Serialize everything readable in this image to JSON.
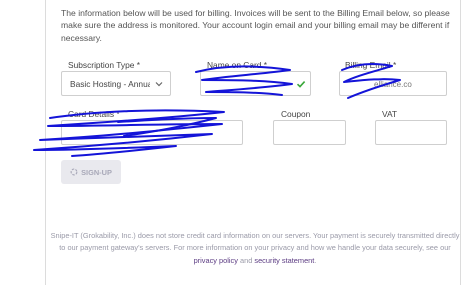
{
  "intro_text": "The information below will be used for billing. Invoices will be sent to the Billing Email below, so please make sure the address is monitored. Your account login email and your billing email may be different if necessary.",
  "form": {
    "subscription_type": {
      "label": "Subscription Type *",
      "value": "Basic Hosting - Annua"
    },
    "name_on_card": {
      "label": "Name on Card *",
      "value": ""
    },
    "billing_email": {
      "label": "Billing Email *",
      "value": "elliance.co"
    },
    "card_details": {
      "label": "Card Details *"
    },
    "coupon": {
      "label": "Coupon",
      "value": ""
    },
    "vat": {
      "label": "VAT",
      "value": ""
    }
  },
  "signup_button": {
    "label": "SIGN-UP"
  },
  "footer": {
    "text_part1": "Snipe-IT (Grokability, Inc.) does not store credit card information on our servers. Your payment is securely transmitted directly to our payment gateway's servers. For more information on your privacy and how we handle your data securely, see our ",
    "privacy_link": "privacy policy",
    "and_text": " and ",
    "security_link": "security statement",
    "end_text": "."
  },
  "colors": {
    "redaction_ink": "#1414d8",
    "check_green": "#3aa83a",
    "link_purple": "#5b3b82"
  }
}
